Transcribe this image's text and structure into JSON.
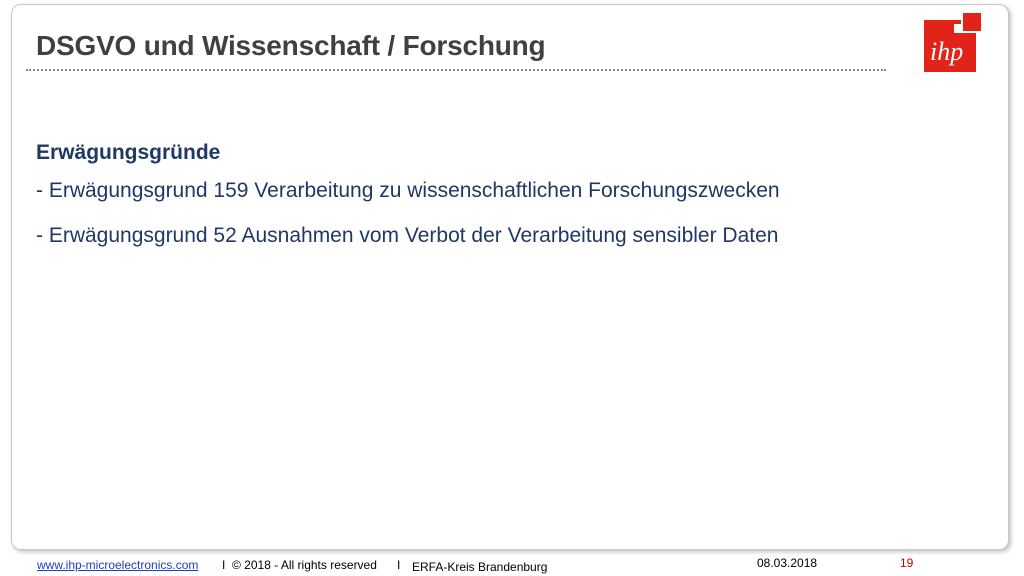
{
  "slide": {
    "title": "DSGVO und Wissenschaft / Forschung",
    "logo_text": "ihp",
    "heading": "Erwägungsgründe",
    "bullets": [
      "- Erwägungsgrund 159 Verarbeitung zu wissenschaftlichen Forschungszwecken",
      "- Erwägungsgrund 52 Ausnahmen vom Verbot der Verarbeitung sensibler Daten"
    ]
  },
  "footer": {
    "website": "www.ihp-microelectronics.com",
    "separator": "I",
    "copyright": "© 2018 - All rights reserved",
    "group": "ERFA-Kreis Brandenburg",
    "date": "08.03.2018",
    "page_number": "19"
  },
  "colors": {
    "title": "#404040",
    "body_text": "#1f3864",
    "logo_red": "#e2231a",
    "link": "#1f3fbf",
    "page_number": "#c00000"
  }
}
